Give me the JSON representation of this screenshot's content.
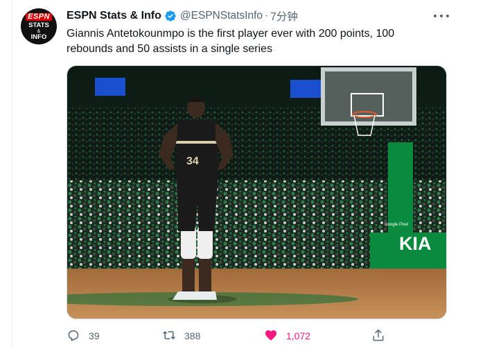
{
  "author": {
    "name": "ESPN Stats & Info",
    "handle": "@ESPNStatsInfo",
    "separator": "·",
    "time": "7分钟",
    "avatar": {
      "line1": "ESPN",
      "line2": "STATS",
      "line3": "&",
      "line4": "INFO"
    }
  },
  "tweet": {
    "text": "Giannis Antetokounmpo is the first player ever with 200 points, 100 rebounds and 50 assists in a single series"
  },
  "media": {
    "jersey_number": "34",
    "sponsor_text": "KIA",
    "stanchion_text": "Google Pixel"
  },
  "actions": {
    "reply_count": "39",
    "retweet_count": "388",
    "like_count": "1,072"
  },
  "colors": {
    "verified": "#1d9bf0",
    "like": "#f91880",
    "secondary_text": "#536471",
    "celtics_green": "#0a8a3c"
  },
  "icons": [
    "more-icon",
    "verified-icon",
    "reply-icon",
    "retweet-icon",
    "heart-icon",
    "share-icon"
  ]
}
